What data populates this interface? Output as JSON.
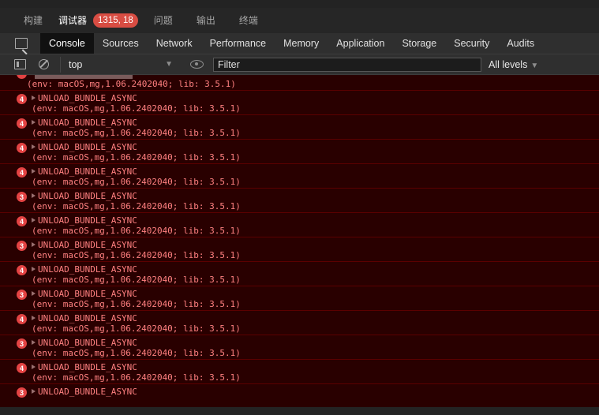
{
  "panel_tabs": {
    "build": "构建",
    "debugger": "调试器",
    "badge": "1315, 18",
    "problems": "问题",
    "output": "输出",
    "terminal": "终端"
  },
  "devtools_tabs": [
    "Console",
    "Sources",
    "Network",
    "Performance",
    "Memory",
    "Application",
    "Storage",
    "Security",
    "Audits"
  ],
  "console_toolbar": {
    "context": "top",
    "filter_placeholder": "Filter",
    "levels": "All levels"
  },
  "first_log_detail": "(env: macOS,mg,1.06.2402040; lib: 3.5.1)",
  "logs": [
    {
      "count": "4",
      "message": "UNLOAD_BUNDLE_ASYNC",
      "detail": "(env: macOS,mg,1.06.2402040; lib: 3.5.1)"
    },
    {
      "count": "4",
      "message": "UNLOAD_BUNDLE_ASYNC",
      "detail": "(env: macOS,mg,1.06.2402040; lib: 3.5.1)"
    },
    {
      "count": "4",
      "message": "UNLOAD_BUNDLE_ASYNC",
      "detail": "(env: macOS,mg,1.06.2402040; lib: 3.5.1)"
    },
    {
      "count": "4",
      "message": "UNLOAD_BUNDLE_ASYNC",
      "detail": "(env: macOS,mg,1.06.2402040; lib: 3.5.1)"
    },
    {
      "count": "3",
      "message": "UNLOAD_BUNDLE_ASYNC",
      "detail": "(env: macOS,mg,1.06.2402040; lib: 3.5.1)"
    },
    {
      "count": "4",
      "message": "UNLOAD_BUNDLE_ASYNC",
      "detail": "(env: macOS,mg,1.06.2402040; lib: 3.5.1)"
    },
    {
      "count": "3",
      "message": "UNLOAD_BUNDLE_ASYNC",
      "detail": "(env: macOS,mg,1.06.2402040; lib: 3.5.1)"
    },
    {
      "count": "4",
      "message": "UNLOAD_BUNDLE_ASYNC",
      "detail": "(env: macOS,mg,1.06.2402040; lib: 3.5.1)"
    },
    {
      "count": "3",
      "message": "UNLOAD_BUNDLE_ASYNC",
      "detail": "(env: macOS,mg,1.06.2402040; lib: 3.5.1)"
    },
    {
      "count": "4",
      "message": "UNLOAD_BUNDLE_ASYNC",
      "detail": "(env: macOS,mg,1.06.2402040; lib: 3.5.1)"
    },
    {
      "count": "3",
      "message": "UNLOAD_BUNDLE_ASYNC",
      "detail": "(env: macOS,mg,1.06.2402040; lib: 3.5.1)"
    },
    {
      "count": "4",
      "message": "UNLOAD_BUNDLE_ASYNC",
      "detail": "(env: macOS,mg,1.06.2402040; lib: 3.5.1)"
    },
    {
      "count": "3",
      "message": "UNLOAD_BUNDLE_ASYNC",
      "detail": ""
    }
  ],
  "colors": {
    "error_background": "#290000",
    "error_text": "#ff8080",
    "badge_red": "#e34343"
  }
}
